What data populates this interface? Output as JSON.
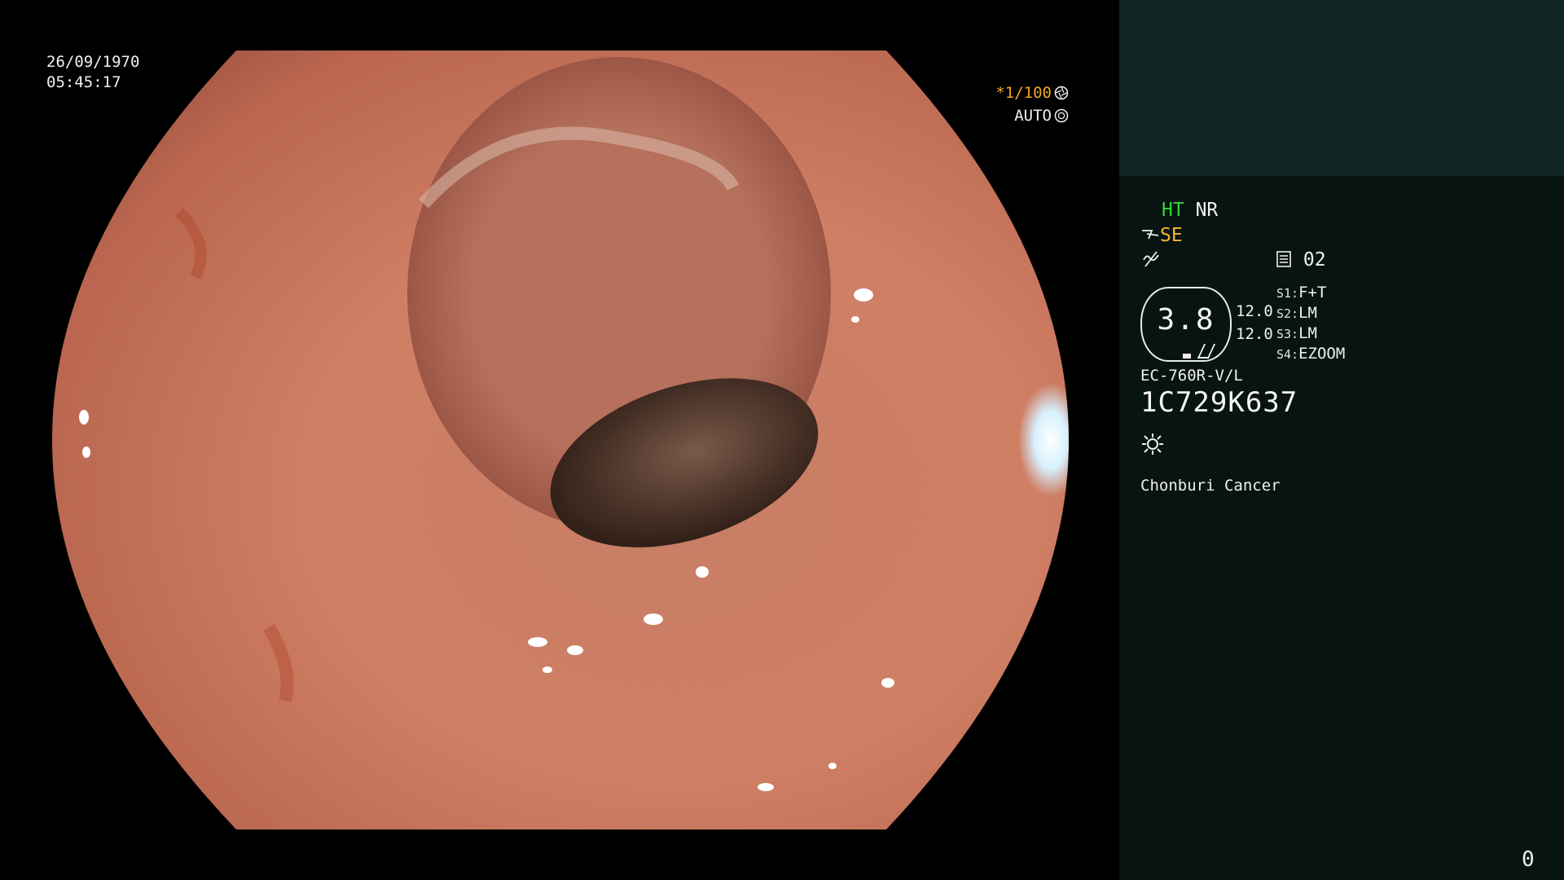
{
  "overlay": {
    "date": "26/09/1970",
    "time": "05:45:17",
    "shutter_speed": "*1/100",
    "exposure_mode": "AUTO"
  },
  "side_panel": {
    "ht": "HT",
    "nr": "NR",
    "se": "SE",
    "storage_number": "02",
    "pill_value": "3.8",
    "pill_right_top": "12.0",
    "pill_right_bottom": "12.0",
    "switches": [
      {
        "key": "S1:",
        "value": "F+T"
      },
      {
        "key": "S2:",
        "value": "LM"
      },
      {
        "key": "S3:",
        "value": "LM"
      },
      {
        "key": "S4:",
        "value": "EZOOM"
      }
    ],
    "scope_model": "EC-760R-V/L",
    "serial": "1C729K637",
    "institution": "Chonburi Cancer",
    "counter": "0"
  },
  "icons": [
    "aperture-icon",
    "iris-icon",
    "scope-tip-icon",
    "zigzag-icon",
    "storage-icon",
    "brightness-icon"
  ],
  "colors": {
    "ht_green": "#38d33c",
    "se_amber": "#f4b52c",
    "shutter_orange": "#f2a62a",
    "panel_bg": "#071412",
    "panel_top_bg": "#102625"
  }
}
